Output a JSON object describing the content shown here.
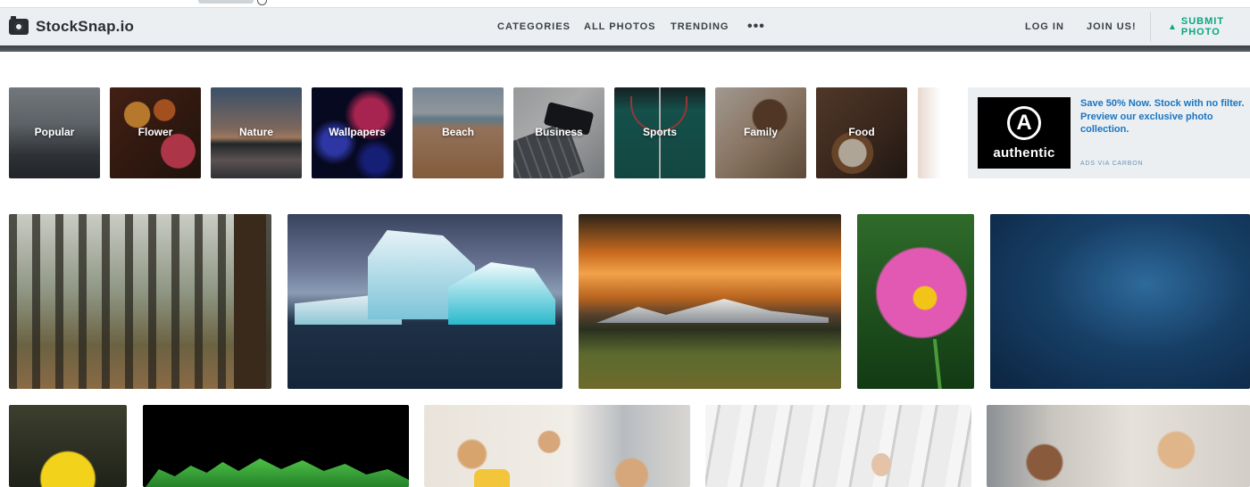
{
  "header": {
    "logo_text": "StockSnap.io",
    "nav": {
      "categories": "CATEGORIES",
      "all_photos": "ALL PHOTOS",
      "trending": "TRENDING",
      "more": "•••",
      "log_in": "LOG IN",
      "join": "JOIN US!",
      "submit": "SUBMIT PHOTO"
    }
  },
  "categories": [
    {
      "label": "Popular"
    },
    {
      "label": "Flower"
    },
    {
      "label": "Nature"
    },
    {
      "label": "Wallpapers"
    },
    {
      "label": "Beach"
    },
    {
      "label": "Business"
    },
    {
      "label": "Sports"
    },
    {
      "label": "Family"
    },
    {
      "label": "Food"
    }
  ],
  "ad": {
    "logo_text": "authentic",
    "body": "Save 50% Now. Stock with no filter. Preview our exclusive photo collection.",
    "via": "ADS VIA CARBON"
  },
  "colors": {
    "header_bg": "#ebeff2",
    "accent_green": "#0aa67e",
    "ad_link": "#1a75c0"
  },
  "icons": {
    "logo": "camera-icon",
    "submit": "upload-icon",
    "ad_mark": "a-circle-icon"
  }
}
